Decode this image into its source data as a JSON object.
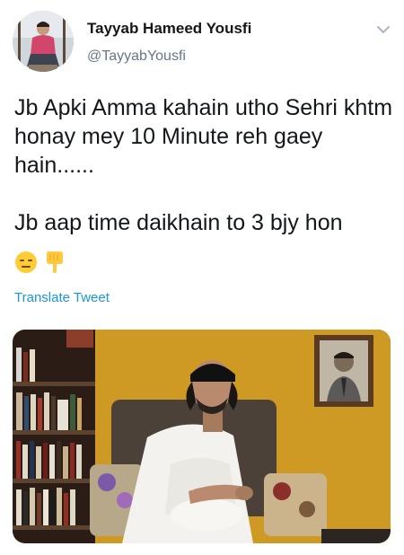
{
  "user": {
    "display_name": "Tayyab Hameed Yousfi",
    "handle": "@TayyabYousfi"
  },
  "tweet": {
    "paragraphs": [
      "Jb Apki Amma kahain utho Sehri khtm honay mey 10 Minute reh gaey hain......",
      "Jb aap time daikhain to 3 bjy hon"
    ],
    "emojis": [
      "expressionless-face",
      "backhand-index-pointing-down"
    ]
  },
  "actions": {
    "translate_label": "Translate Tweet"
  },
  "icons": {
    "more": "chevron-down-icon"
  },
  "colors": {
    "link": "#1b95e0",
    "secondary_text": "#657786",
    "primary_text": "#14171a"
  }
}
